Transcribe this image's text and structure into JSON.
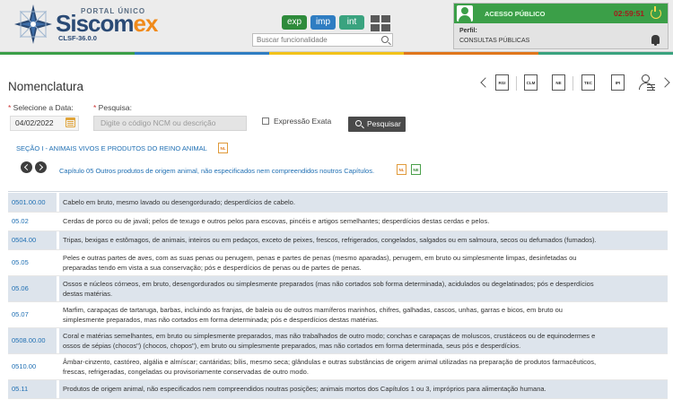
{
  "header": {
    "portal_label": "PORTAL ÚNICO",
    "logo_main": "Siscom",
    "logo_ex": "ex",
    "logo_version": "CLSF-36.0.0",
    "modules": [
      "exp",
      "imp",
      "int"
    ],
    "search_placeholder": "Buscar funcionalidade"
  },
  "user": {
    "access_label": "ACESSO PÚBLICO",
    "clock": "02:59:51",
    "perfil_label": "Perfil:",
    "perfil_value": "CONSULTAS PÚBLICAS"
  },
  "page": {
    "title": "Nomenclatura"
  },
  "toolbar": {
    "docs": [
      "RGI",
      "CLM",
      "NE",
      "TEC",
      "IPI"
    ]
  },
  "form": {
    "date_label": "Selecione a Data:",
    "date_value": "04/02/2022",
    "search_label": "Pesquisa:",
    "search_placeholder": "Digite o código NCM ou descrição",
    "exact_label": "Expressão Exata",
    "search_button": "Pesquisar"
  },
  "breadcrumb": {
    "section": "SEÇÃO I - ANIMAIS VIVOS E PRODUTOS DO REINO ANIMAL",
    "chapter": "Capítulo 05   Outros produtos de origem animal, não especificados nem compreendidos noutros Capítulos.",
    "nl": "NL",
    "ne": "NE"
  },
  "rows": [
    {
      "code": "0501.00.00",
      "line1": "Cabelo em bruto, mesmo lavado ou desengordurado; desperdícios de cabelo.",
      "line2": ""
    },
    {
      "code": "05.02",
      "line1": "Cerdas de porco ou de javali; pelos de texugo e outros pelos para escovas, pincéis e artigos semelhantes; desperdícios destas cerdas e pelos.",
      "line2": ""
    },
    {
      "code": "0504.00",
      "line1": "Tripas, bexigas e estômagos, de animais, inteiros ou em pedaços, exceto de peixes, frescos, refrigerados, congelados, salgados ou em salmoura, secos ou defumados (fumados).",
      "line2": ""
    },
    {
      "code": "05.05",
      "line1": "Peles e outras partes de aves, com as suas penas ou penugem, penas e partes de penas (mesmo aparadas), penugem, em bruto ou simplesmente limpas, desinfetadas ou",
      "line2": "preparadas tendo em vista a sua conservação; pós e desperdícios de penas ou de partes de penas."
    },
    {
      "code": "05.06",
      "line1": "Ossos e núcleos córneos, em bruto, desengordurados ou simplesmente preparados (mas não cortados sob forma determinada), acidulados ou degelatinados; pós e desperdícios",
      "line2": "destas matérias."
    },
    {
      "code": "05.07",
      "line1": "Marfim, carapaças de tartaruga, barbas, incluindo as franjas, de baleia ou de outros mamíferos marinhos, chifres, galhadas, cascos, unhas, garras e bicos, em bruto ou",
      "line2": "simplesmente preparados, mas não cortados em forma determinada; pós e desperdícios destas matérias."
    },
    {
      "code": "0508.00.00",
      "line1": "Coral e matérias semelhantes, em bruto ou simplesmente preparados, mas não trabalhados de outro modo; conchas e carapaças de moluscos, crustáceos ou de equinodermes e",
      "line2": "ossos de sépias (chocos\") (chocos, chopos\"), em bruto ou simplesmente preparados, mas não cortados em forma determinada, seus pós e desperdícios."
    },
    {
      "code": "0510.00",
      "line1": "Âmbar-cinzento, castóreo, algália e almíscar; cantáridas; bílis, mesmo seca; glândulas e outras substâncias de origem animal utilizadas na preparação de produtos farmacêuticos,",
      "line2": "frescas, refrigeradas, congeladas ou provisoriamente conservadas de outro modo."
    },
    {
      "code": "05.11",
      "line1": "Produtos de origem animal, não especificados nem compreendidos noutras posições; animais mortos dos Capítulos 1 ou 3, impróprios para alimentação humana.",
      "line2": ""
    }
  ]
}
